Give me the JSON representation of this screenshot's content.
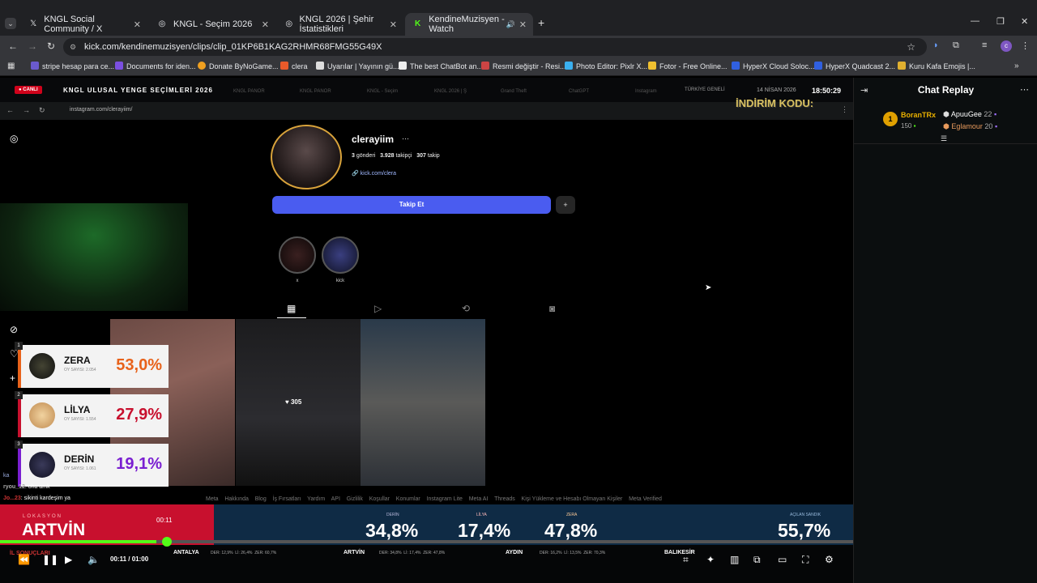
{
  "browser": {
    "tabs": [
      {
        "title": "KNGL Social Community / X",
        "icon": "x-logo-icon"
      },
      {
        "title": "KNGL - Seçim 2026",
        "icon": "globe-icon"
      },
      {
        "title": "KNGL 2026 | Şehir İstatistikleri",
        "icon": "globe-icon"
      },
      {
        "title": "KendineMuzisyen - Watch",
        "icon": "kick-logo-icon",
        "active": true
      }
    ],
    "url": "kick.com/kendinemuzisyen/clips/clip_01KP6B1KAG2RHMR68FMG55G49X",
    "bookmarks": [
      {
        "label": "stripe hesap para ce...",
        "color": "#6a5acd"
      },
      {
        "label": "Documents for iden...",
        "color": "#7b4fe0"
      },
      {
        "label": "Donate ByNoGame...",
        "color": "#f0a020"
      },
      {
        "label": "clera",
        "color": "#e85a2a"
      },
      {
        "label": "Uyarılar | Yayının gü...",
        "color": "#ddd"
      },
      {
        "label": "The best ChatBot an...",
        "color": "#eee"
      },
      {
        "label": "Resmi değiştir - Resi...",
        "color": "#cc4444"
      },
      {
        "label": "Photo Editor: Pixlr X...",
        "color": "#3ab0f0"
      },
      {
        "label": "Fotor - Free Online...",
        "color": "#f0c030"
      },
      {
        "label": "HyperX Cloud Soloc...",
        "color": "#3060e0"
      },
      {
        "label": "HyperX Quadcast 2...",
        "color": "#3060e0"
      },
      {
        "label": "Kuru Kafa Emojis |...",
        "color": "#e0b030"
      }
    ]
  },
  "stream": {
    "live_badge": "CANLI",
    "overlay_title": "KNGL ULUSAL YENGE SEÇİMLERİ 2026",
    "region": "TÜRKİYE GENELİ",
    "date": "14 NİSAN 2026",
    "clock": "18:50:29",
    "promo": "İNDİRİM KODU:",
    "inner_tabs": [
      "KNGL PANOR",
      "KNGL PANOR",
      "KNGL - Seçim",
      "KNGL 2026 | Ş",
      "Grand Theft",
      "ChatGPT",
      "Instagram"
    ],
    "inner_url": "instagram.com/clerayiim/"
  },
  "instagram": {
    "username": "clerayiim",
    "posts": "3",
    "posts_label": "gönderi",
    "followers": "3.928",
    "followers_label": "takipçi",
    "following": "307",
    "following_label": "takip",
    "link": "kick.com/clera",
    "follow_button": "Takip Et",
    "highlights": [
      "x",
      "kick"
    ],
    "post_likes": "305",
    "footer_links": [
      "Meta",
      "Hakkında",
      "Blog",
      "İş Fırsatları",
      "Yardım",
      "API",
      "Gizlilik",
      "Koşullar",
      "Konumlar",
      "Instagram Lite",
      "Meta AI",
      "Threads",
      "Kişi Yükleme ve Hesabı Olmayan Kişiler",
      "Meta Verified"
    ]
  },
  "poll": [
    {
      "rank": "1",
      "name": "ZERA",
      "votes": "OY SAYISI: 2.054",
      "pct": "53,0%",
      "color": "#e8621a"
    },
    {
      "rank": "2",
      "name": "LİLYA",
      "votes": "OY SAYISI: 1.554",
      "pct": "27,9%",
      "color": "#c8102e"
    },
    {
      "rank": "3",
      "name": "DERİN",
      "votes": "OY SAYISI: 1.061",
      "pct": "19,1%",
      "color": "#7a1fd1"
    }
  ],
  "stream_chat": [
    {
      "user": "ka",
      "text": ""
    },
    {
      "user": "ryou_12",
      "text": ": oha amk"
    },
    {
      "user": "Jo...23",
      "text": ": sikinti kardeşim ya"
    }
  ],
  "ticker": {
    "location_label": "LOKASYON",
    "location": "ARTVİN",
    "timer": "00:11",
    "derin_label": "DERİN",
    "derin": "34,8%",
    "lilya_label": "LİLYA",
    "lilya": "17,4%",
    "zera_label": "ZERA",
    "zera": "47,8%",
    "chest_label": "AÇILAN SANDIK",
    "chest": "55,7%",
    "cities": [
      {
        "name": "ANTALYA",
        "der": "DER: 12,9%",
        "lil": "Lİ: 26,4%",
        "zer": "ZER: 60,7%"
      },
      {
        "name": "ARTVİN",
        "der": "DER: 34,8%",
        "lil": "Lİ: 17,4%",
        "zer": "ZER: 47,8%"
      },
      {
        "name": "AYDIN",
        "der": "DER: 16,2%",
        "lil": "Lİ: 13,5%",
        "zer": "ZER: 70,3%"
      },
      {
        "name": "BALIKESİR",
        "der": "",
        "lil": "",
        "zer": ""
      }
    ],
    "left_label": "İL SONUÇLARI"
  },
  "player": {
    "time": "00:11 / 01:00",
    "progress": 0.1833
  },
  "chat": {
    "title": "Chat Replay",
    "top_user": "BoranTRx",
    "top_user_count": "150",
    "gifter1": "ApuuGee",
    "gifter1_count": "22",
    "gifter2": "Eglamour",
    "gifter2_count": "20"
  },
  "colors": {
    "kick_green": "#53fc18",
    "follow_blue": "#4a5cf0",
    "ticker_red": "#c8102e",
    "ticker_navy": "#0f2b45"
  }
}
